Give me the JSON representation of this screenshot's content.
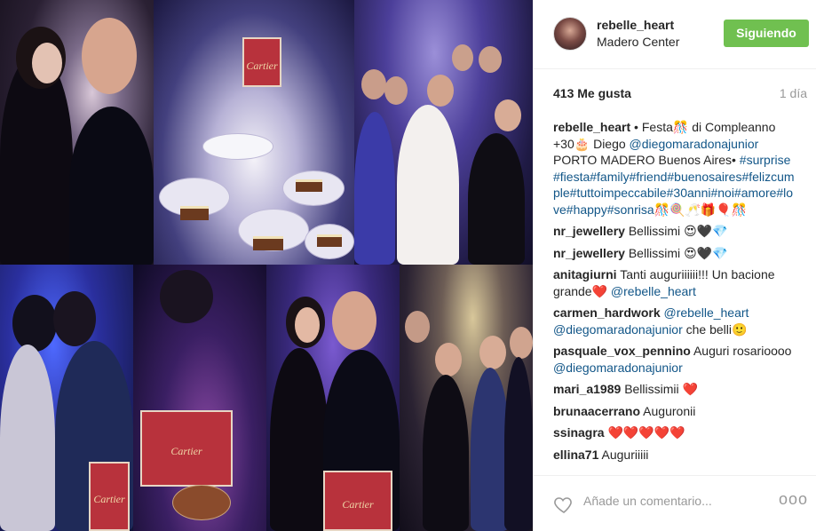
{
  "post": {
    "username": "rebelle_heart",
    "location": "Madero Center",
    "follow_label": "Siguiendo",
    "likes": "413 Me gusta",
    "time_ago": "1 día",
    "add_comment_placeholder": "Añade un comentario...",
    "more_label": "ooo"
  },
  "photo": {
    "bag_brand": "Cartier"
  },
  "caption": {
    "user": "rebelle_heart",
    "text1": " • Festa",
    "emoji1": "🎊",
    "text2": " di Compleanno +30",
    "emoji2": "🎂",
    "text3": " Diego ",
    "mention": "@diegomaradonajunior",
    "text4": " PORTO MADERO Buenos Aires• ",
    "hashtags": "#surprise#fiesta#family#friend#buenosaires#felizcumple#tuttoimpeccabile#30anni#noi#amore#love#happy#sonrisa",
    "emoji_tail": "🎊🍭🥂🎁🎈🎊"
  },
  "comments": [
    {
      "user": "nr_jewellery",
      "text": "Bellissimi",
      "emoji": "😍🖤💎"
    },
    {
      "user": "nr_jewellery",
      "text": "Bellissimi",
      "emoji": "😍🖤💎"
    },
    {
      "user": "anitagiurni",
      "text": "Tanti auguriiiiii!!! Un bacione grande",
      "emoji": "❤️",
      "mention": "@rebelle_heart"
    },
    {
      "user": "carmen_hardwork",
      "text": "che belli",
      "emoji": "🙂",
      "mention": "@rebelle_heart @diegomaradonajunior"
    },
    {
      "user": "pasquale_vox_pennino",
      "text": "Auguri rosarioooo",
      "mention": "@diegomaradonajunior"
    },
    {
      "user": "mari_a1989",
      "text": "Bellissimii",
      "emoji": "❤️"
    },
    {
      "user": "brunaacerrano",
      "text": "Auguronii"
    },
    {
      "user": "ssinagra",
      "emoji": "❤️❤️❤️❤️❤️"
    },
    {
      "user": "ellina71",
      "text": "Auguriiiii"
    }
  ]
}
